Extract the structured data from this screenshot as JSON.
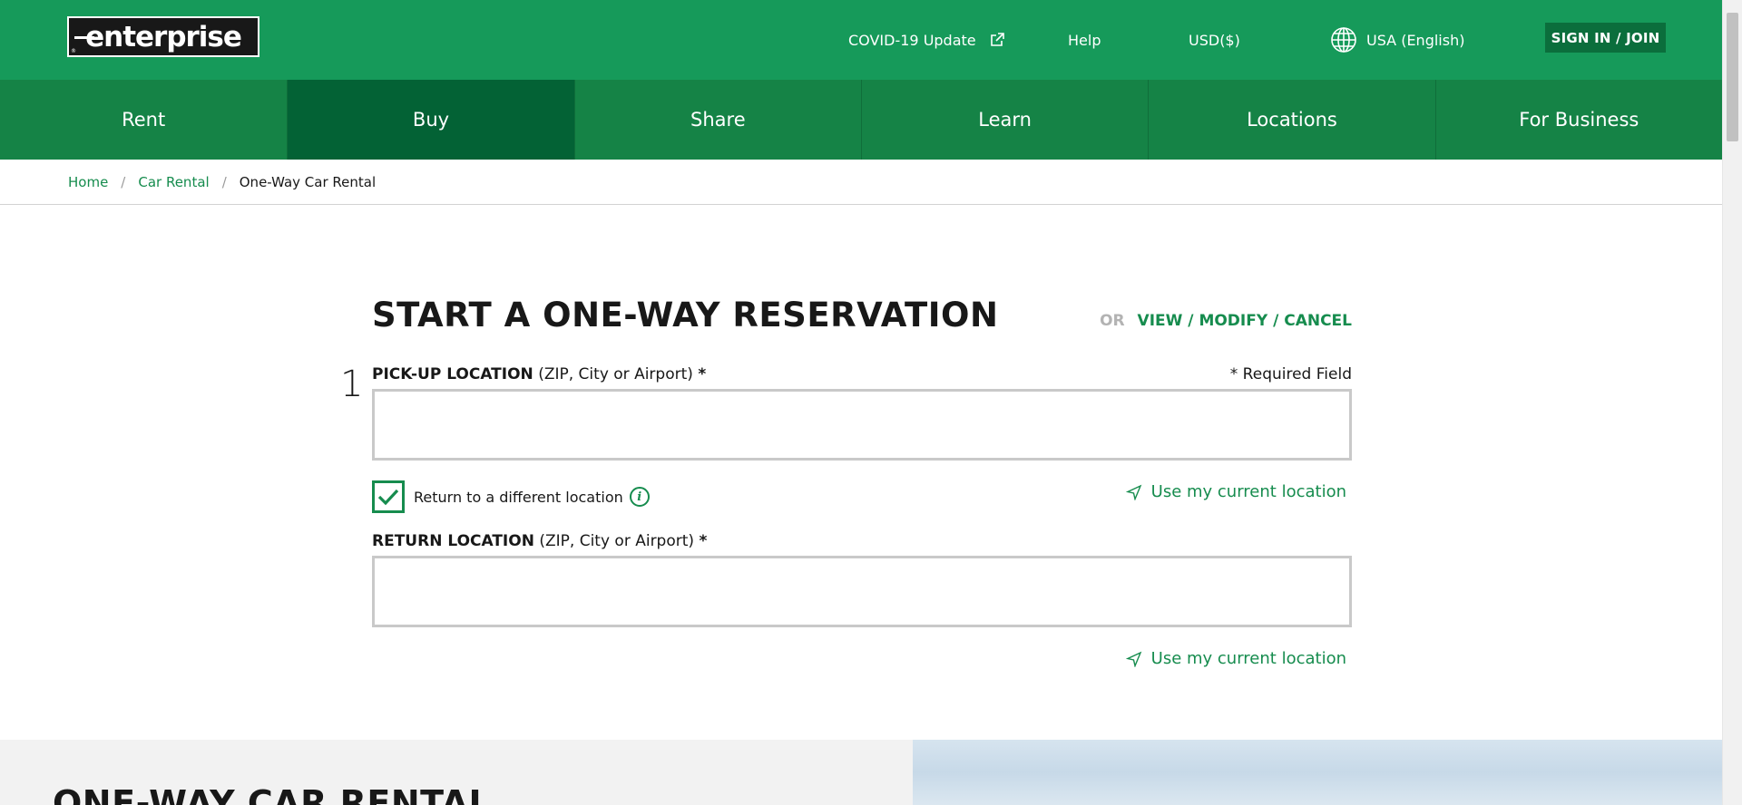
{
  "header": {
    "logo_text": "enterprise",
    "covid_label": "COVID-19 Update",
    "help_label": "Help",
    "currency_label": "USD($)",
    "language_label": "USA (English)",
    "signin_label": "SIGN IN / JOIN"
  },
  "nav": {
    "tabs": [
      {
        "label": "Rent",
        "active": false
      },
      {
        "label": "Buy",
        "active": true
      },
      {
        "label": "Share",
        "active": false
      },
      {
        "label": "Learn",
        "active": false
      },
      {
        "label": "Locations",
        "active": false
      },
      {
        "label": "For Business",
        "active": false
      }
    ]
  },
  "breadcrumb": {
    "items": [
      "Home",
      "Car Rental"
    ],
    "separator": "/",
    "current": "One-Way Car Rental"
  },
  "form": {
    "title": "START A ONE-WAY RESERVATION",
    "or_label": "OR",
    "view_modify_cancel": "VIEW / MODIFY / CANCEL",
    "step_number": "1",
    "required_note": "* Required Field",
    "pickup": {
      "label": "PICK-UP LOCATION",
      "hint": "(ZIP, City or Airport)",
      "required_mark": "*",
      "value": "",
      "placeholder": ""
    },
    "return_checkbox": {
      "label": "Return to a different location",
      "checked": true
    },
    "info_icon_glyph": "i",
    "return": {
      "label": "RETURN LOCATION",
      "hint": "(ZIP, City or Airport)",
      "required_mark": "*",
      "value": "",
      "placeholder": ""
    },
    "current_location_label": "Use my current location"
  },
  "lower": {
    "heading": "ONE-WAY CAR RENTAL"
  },
  "colors": {
    "header_green": "#169a5a",
    "nav_green": "#158346",
    "nav_active": "#036235",
    "signin_bg": "#0b6e3c",
    "link_green": "#168c4e",
    "text_dark": "#181818"
  }
}
